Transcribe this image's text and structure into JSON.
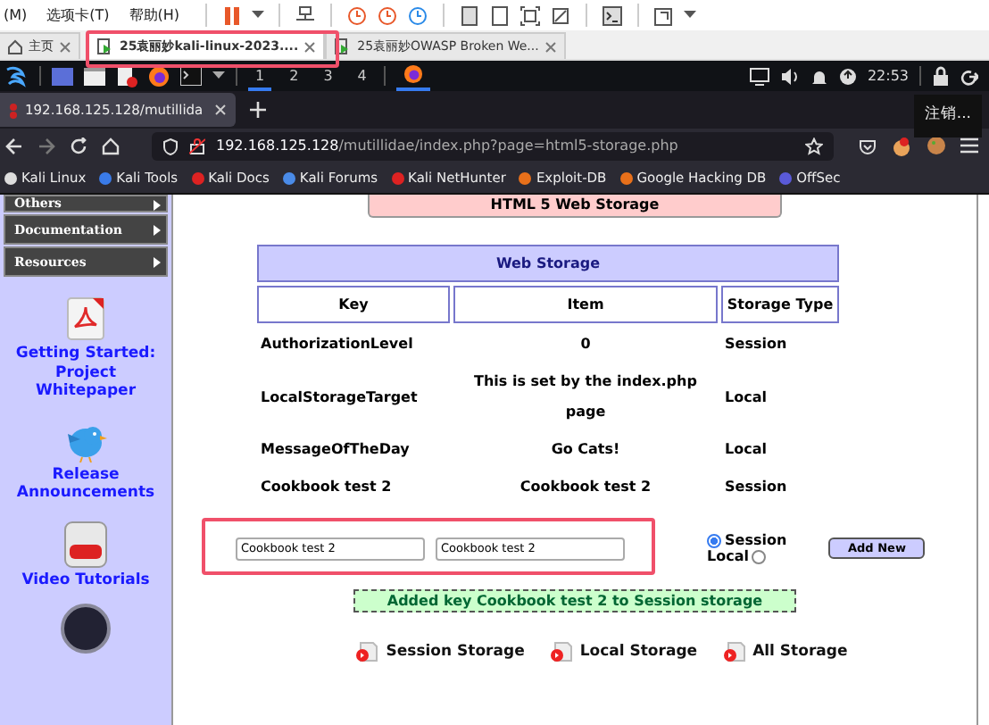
{
  "vm_menu": [
    "(M)",
    "选项卡(T)",
    "帮助(H)"
  ],
  "vm_tabs": [
    {
      "label": "主页",
      "selected": false
    },
    {
      "label": "25袁丽妙kali-linux-2023....",
      "selected": true
    },
    {
      "label": "25袁丽妙OWASP Broken We...",
      "selected": false
    }
  ],
  "taskbar": {
    "workspaces": [
      {
        "label": "1",
        "selected": true
      },
      {
        "label": "2",
        "selected": false
      },
      {
        "label": "3",
        "selected": false
      },
      {
        "label": "4",
        "selected": false
      }
    ],
    "clock": "22:53"
  },
  "browser": {
    "tab": {
      "title": "192.168.125.128/mutillida"
    },
    "tooltip": "注销...",
    "url": {
      "host": "192.168.125.128",
      "path": "/mutillidae/index.php?page=html5-storage.php"
    },
    "bookmarks": [
      {
        "label": "Kali Linux"
      },
      {
        "label": "Kali Tools"
      },
      {
        "label": "Kali Docs"
      },
      {
        "label": "Kali Forums"
      },
      {
        "label": "Kali NetHunter"
      },
      {
        "label": "Exploit-DB"
      },
      {
        "label": "Google Hacking DB"
      },
      {
        "label": "OffSec"
      }
    ]
  },
  "sidebar": {
    "menu": [
      "Others",
      "Documentation",
      "Resources"
    ],
    "links": [
      {
        "kind": "pdf",
        "label": "Getting Started: Project Whitepaper"
      },
      {
        "kind": "bird",
        "label": "Release Announcements"
      },
      {
        "kind": "video",
        "label": "Video Tutorials"
      }
    ]
  },
  "page": {
    "heading": "HTML 5 Web Storage",
    "table": {
      "title": "Web Storage",
      "columns": [
        "Key",
        "Item",
        "Storage Type"
      ],
      "rows": [
        [
          "AuthorizationLevel",
          "0",
          "Session"
        ],
        [
          "LocalStorageTarget",
          "This is set by the index.php page",
          "Local"
        ],
        [
          "MessageOfTheDay",
          "Go Cats!",
          "Local"
        ],
        [
          "Cookbook test 2",
          "Cookbook test 2",
          "Session"
        ]
      ]
    },
    "form": {
      "key_value": "Cookbook test 2",
      "item_value": "Cookbook test 2",
      "options": [
        {
          "label": "Session",
          "selected": true
        },
        {
          "label": "Local",
          "selected": false
        }
      ],
      "button": "Add New"
    },
    "message": "Added key Cookbook test 2 to Session storage",
    "links": [
      "Session Storage",
      "Local Storage",
      "All Storage"
    ]
  }
}
